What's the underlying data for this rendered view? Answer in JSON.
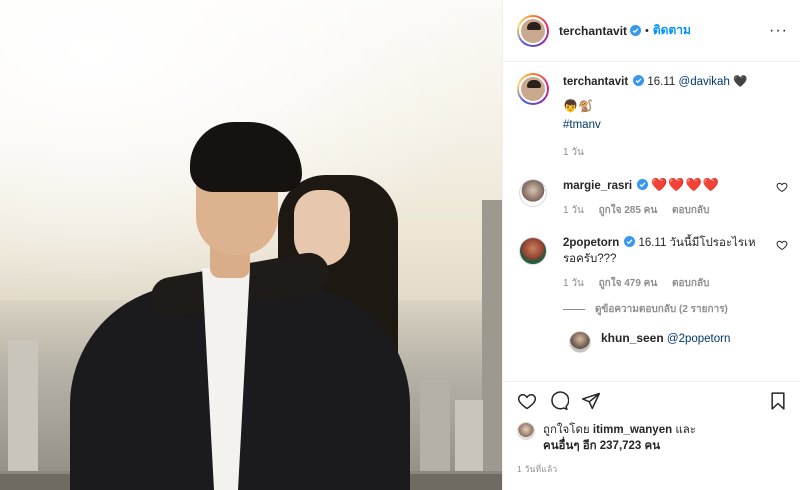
{
  "header": {
    "username": "terchantavit",
    "separator": "•",
    "follow_label": "ติดตาม",
    "more_label": "···"
  },
  "caption": {
    "username": "terchantavit",
    "text": "16.11",
    "mention": "@davikah",
    "heart": "🖤",
    "emojis": "👦🐒",
    "hashtag": "#tmanv",
    "time": "1 วัน"
  },
  "comments": [
    {
      "username": "margie_rasri",
      "text": "❤️❤️❤️❤️",
      "time": "1 วัน",
      "likes": "ถูกใจ 285 คน",
      "reply_label": "ตอบกลับ"
    },
    {
      "username": "2popetorn",
      "text": "16.11 วันนี้มีโปรอะไรเหรอครับ???",
      "time": "1 วัน",
      "likes": "ถูกใจ 479 คน",
      "reply_label": "ตอบกลับ"
    }
  ],
  "view_replies": "ดูข้อความตอบกลับ (2 รายการ)",
  "reply": {
    "username": "khun_seen",
    "mention": "@2popetorn"
  },
  "likes_summary": {
    "prefix": "ถูกใจโดย",
    "liker": "itimm_wanyen",
    "and": "และ",
    "others": "คนอื่นๆ อีก 237,723 คน"
  },
  "post_time": "1 วันที่แล้ว",
  "colors": {
    "link": "#00376b",
    "follow": "#0095f6",
    "verified": "#3897f0",
    "heart": "#ed4956",
    "muted": "#8e8e8e"
  },
  "icons": [
    "heart-icon",
    "comment-icon",
    "share-icon",
    "bookmark-icon",
    "verified-icon",
    "more-icon"
  ]
}
